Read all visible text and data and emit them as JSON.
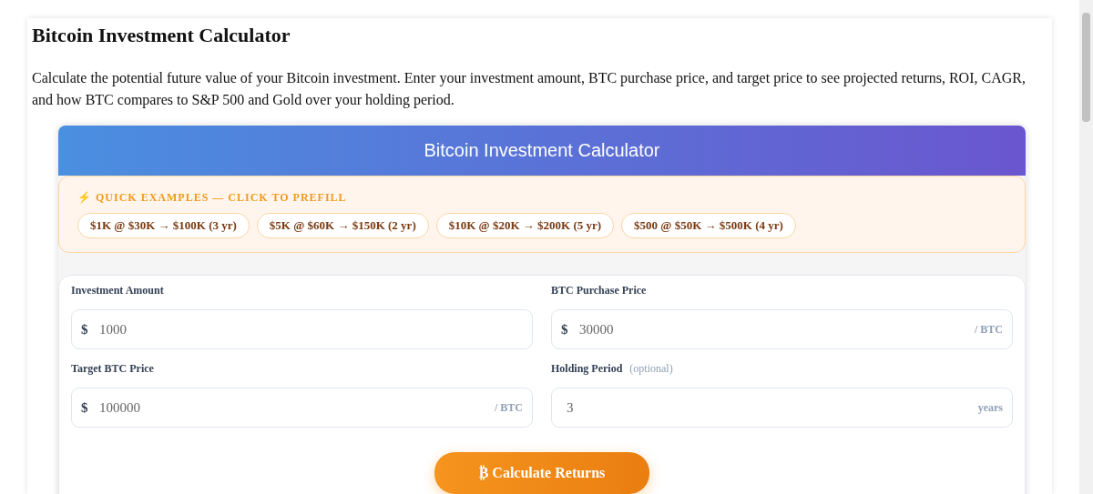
{
  "page": {
    "title": "Bitcoin Investment Calculator",
    "intro": "Calculate the potential future value of your Bitcoin investment. Enter your investment amount, BTC purchase price, and target price to see projected returns, ROI, CAGR, and how BTC compares to S&P 500 and Gold over your holding period."
  },
  "calculator": {
    "title": "Bitcoin Investment Calculator",
    "quick_examples": {
      "heading": "⚡ QUICK EXAMPLES — CLICK TO PREFILL",
      "items": [
        {
          "label": "$1K @ $30K → $100K (3 yr)"
        },
        {
          "label": "$5K @ $60K → $150K (2 yr)"
        },
        {
          "label": "$10K @ $20K → $200K (5 yr)"
        },
        {
          "label": "$500 @ $50K → $500K (4 yr)"
        }
      ]
    },
    "fields": [
      {
        "label": "Investment Amount",
        "prefix": "$",
        "placeholder": "1000"
      },
      {
        "label": "BTC Purchase Price",
        "prefix": "$",
        "placeholder": "30000",
        "suffix": "/ BTC"
      },
      {
        "label": "Target BTC Price",
        "prefix": "$",
        "placeholder": "100000",
        "suffix": "/ BTC"
      },
      {
        "label": "Holding Period",
        "note": "(optional)",
        "placeholder": "3",
        "suffix": "years"
      }
    ],
    "submit": {
      "icon": "₿",
      "label": "Calculate Returns"
    }
  }
}
